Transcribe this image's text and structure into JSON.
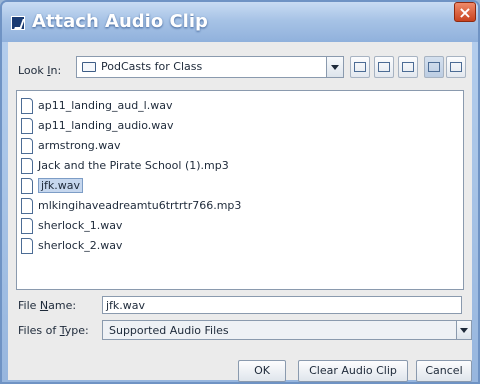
{
  "window": {
    "title": "Attach Audio Clip",
    "close_label": "×"
  },
  "lookin": {
    "label_prefix": "Look ",
    "label_underlined": "I",
    "label_suffix": "n:",
    "selected": "PodCasts for Class"
  },
  "toolbar_icons": [
    "up-one-level-icon",
    "home-icon",
    "new-folder-icon",
    "list-view-icon",
    "details-view-icon"
  ],
  "files": [
    "ap11_landing_aud_l.wav",
    "ap11_landing_audio.wav",
    "armstrong.wav",
    "Jack and the Pirate School (1).mp3",
    "jfk.wav",
    "mlkingihaveadreamtu6trtrtr766.mp3",
    "sherlock_1.wav",
    "sherlock_2.wav"
  ],
  "selected_file_index": 4,
  "filename": {
    "label_prefix": "File ",
    "label_underlined": "N",
    "label_suffix": "ame:",
    "value": "jfk.wav"
  },
  "filetype": {
    "label_prefix": "Files of ",
    "label_underlined": "T",
    "label_suffix": "ype:",
    "value": "Supported Audio Files"
  },
  "buttons": {
    "ok": "OK",
    "clear": "Clear Audio Clip",
    "cancel": "Cancel"
  },
  "colors": {
    "title_gradient_top": "#c9dcf3",
    "close_red": "#c8421f",
    "selection": "#c6d7ee"
  }
}
